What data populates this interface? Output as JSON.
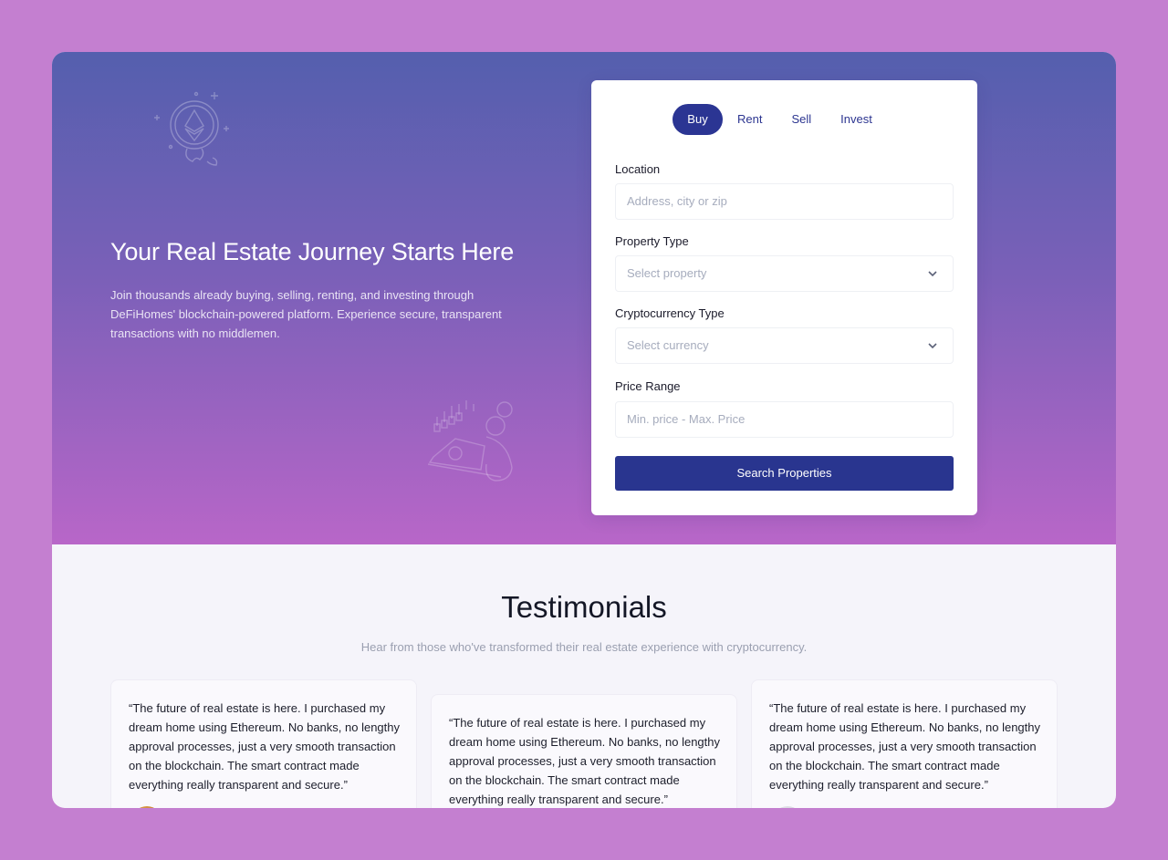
{
  "hero": {
    "title": "Your Real Estate Journey Starts Here",
    "description": "Join thousands already buying, selling, renting, and investing through DeFiHomes' blockchain-powered platform. Experience secure, transparent transactions with no middlemen."
  },
  "search": {
    "tabs": [
      {
        "label": "Buy",
        "active": true
      },
      {
        "label": "Rent",
        "active": false
      },
      {
        "label": "Sell",
        "active": false
      },
      {
        "label": "Invest",
        "active": false
      }
    ],
    "location_label": "Location",
    "location_placeholder": "Address, city or zip",
    "property_type_label": "Property Type",
    "property_type_value": "Select property",
    "crypto_label": "Cryptocurrency Type",
    "crypto_value": "Select currency",
    "price_label": "Price Range",
    "price_placeholder": "Min. price - Max. Price",
    "submit_label": "Search Properties"
  },
  "testimonials": {
    "title": "Testimonials",
    "subtitle": "Hear from those who've transformed their real estate experience with cryptocurrency.",
    "items": [
      {
        "quote": "“The future of real estate is here. I purchased my dream home using Ethereum. No banks, no lengthy approval processes, just a very smooth transaction on the blockchain. The smart contract made everything really transparent and secure.”"
      },
      {
        "quote": "“The future of real estate is here. I purchased my dream home using Ethereum. No banks, no lengthy approval processes, just a very smooth transaction on the blockchain. The smart contract made everything really transparent and secure.”"
      },
      {
        "quote": "“The future of real estate is here. I purchased my dream home using Ethereum. No banks, no lengthy approval processes, just a very smooth transaction on the blockchain. The smart contract made everything really transparent and secure.”"
      }
    ]
  },
  "icons": {
    "ethereum_deco": "ethereum-coin-icon",
    "trader_deco": "crypto-trader-icon",
    "chevron": "chevron-down-icon"
  },
  "colors": {
    "page_bg": "#c47fd0",
    "hero_top": "#545fae",
    "hero_bottom": "#b866c8",
    "accent": "#2b3593"
  }
}
